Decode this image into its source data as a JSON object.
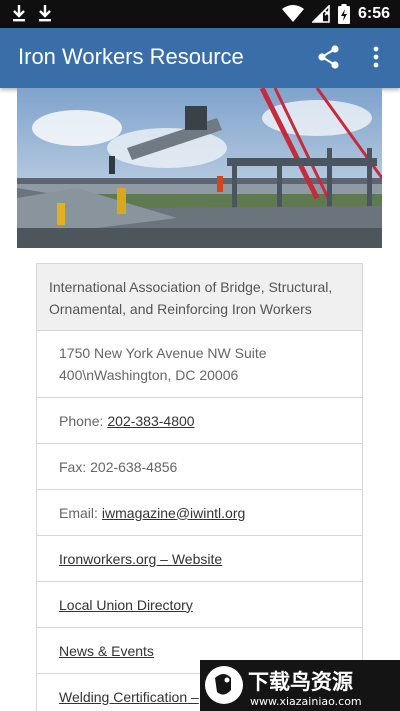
{
  "status_bar": {
    "time": "6:56"
  },
  "app_bar": {
    "title": "Iron Workers Resource",
    "share_icon": "share-icon",
    "menu_icon": "more-vertical-icon"
  },
  "card": {
    "header": "International Association of Bridge, Structural, Ornamental, and Reinforcing Iron Workers",
    "address": "1750 New York Avenue NW Suite 400\\nWashington, DC 20006",
    "phone_label": "Phone:",
    "phone": "202-383-4800",
    "fax": "Fax: 202-638-4856",
    "email_label": "Email:",
    "email": "iwmagazine@iwintl.org",
    "links": [
      "Ironworkers.org – Website",
      "Local Union Directory",
      "News & Events",
      "Welding Certification –"
    ]
  },
  "watermark": {
    "title": "下载鸟资源",
    "url": "www.xiazainiao.com"
  },
  "colors": {
    "app_bar": "#3a6ea8",
    "status_bar": "#0f0f0f",
    "card_header_bg": "#f0f0f0",
    "border": "#d7d7d7"
  }
}
